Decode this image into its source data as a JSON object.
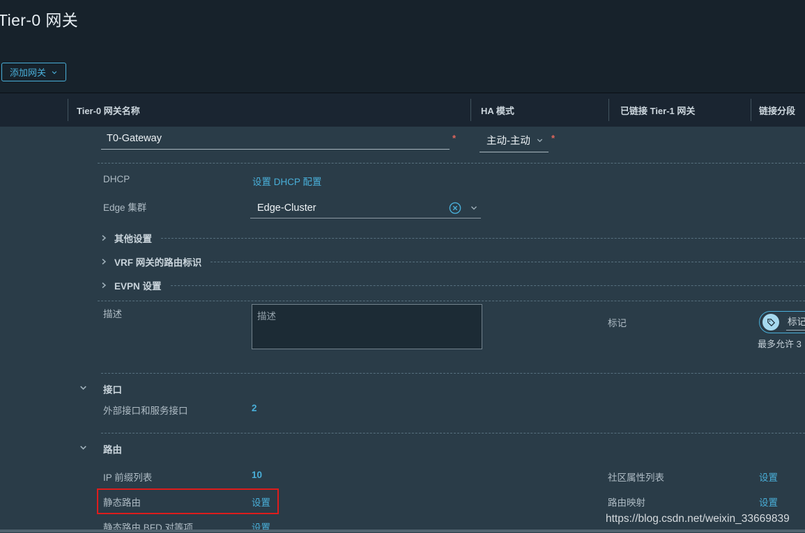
{
  "page": {
    "title": "Tier-0 网关"
  },
  "toolbar": {
    "add_gateway_label": "添加网关"
  },
  "table": {
    "headers": {
      "name": "Tier-0 网关名称",
      "ha_mode": "HA 模式",
      "linked_tier1": "已链接 Tier-1 网关",
      "linked_segments": "链接分段"
    }
  },
  "form": {
    "gateway_name": "T0-Gateway",
    "ha_mode": "主动-主动",
    "required_marker": "*",
    "dhcp": {
      "label": "DHCP",
      "action": "设置 DHCP 配置"
    },
    "edge_cluster": {
      "label": "Edge 集群",
      "value": "Edge-Cluster"
    },
    "collapsed_sections": {
      "other": "其他设置",
      "vrf": "VRF 网关的路由标识",
      "evpn": "EVPN 设置"
    },
    "description": {
      "label": "描述",
      "placeholder": "描述"
    },
    "tags": {
      "label": "标记",
      "input_placeholder": "标记",
      "hint": "最多允许 3"
    },
    "interfaces": {
      "title": "接口",
      "external_row": {
        "label": "外部接口和服务接口",
        "value": "2"
      }
    },
    "routing": {
      "title": "路由",
      "ip_prefix": {
        "label": "IP 前缀列表",
        "value": "10"
      },
      "static_routes": {
        "label": "静态路由",
        "action": "设置"
      },
      "bfd_peers": {
        "label": "静态路由 BFD 对等项",
        "action": "设置"
      },
      "community_lists": {
        "label": "社区属性列表",
        "action": "设置"
      },
      "route_maps": {
        "label": "路由映射",
        "action": "设置"
      }
    }
  },
  "watermark": "https://blog.csdn.net/weixin_33669839",
  "colors": {
    "accent_blue": "#49afd9",
    "highlight_red": "#de1c1c",
    "asterisk_red": "#e0665c"
  }
}
